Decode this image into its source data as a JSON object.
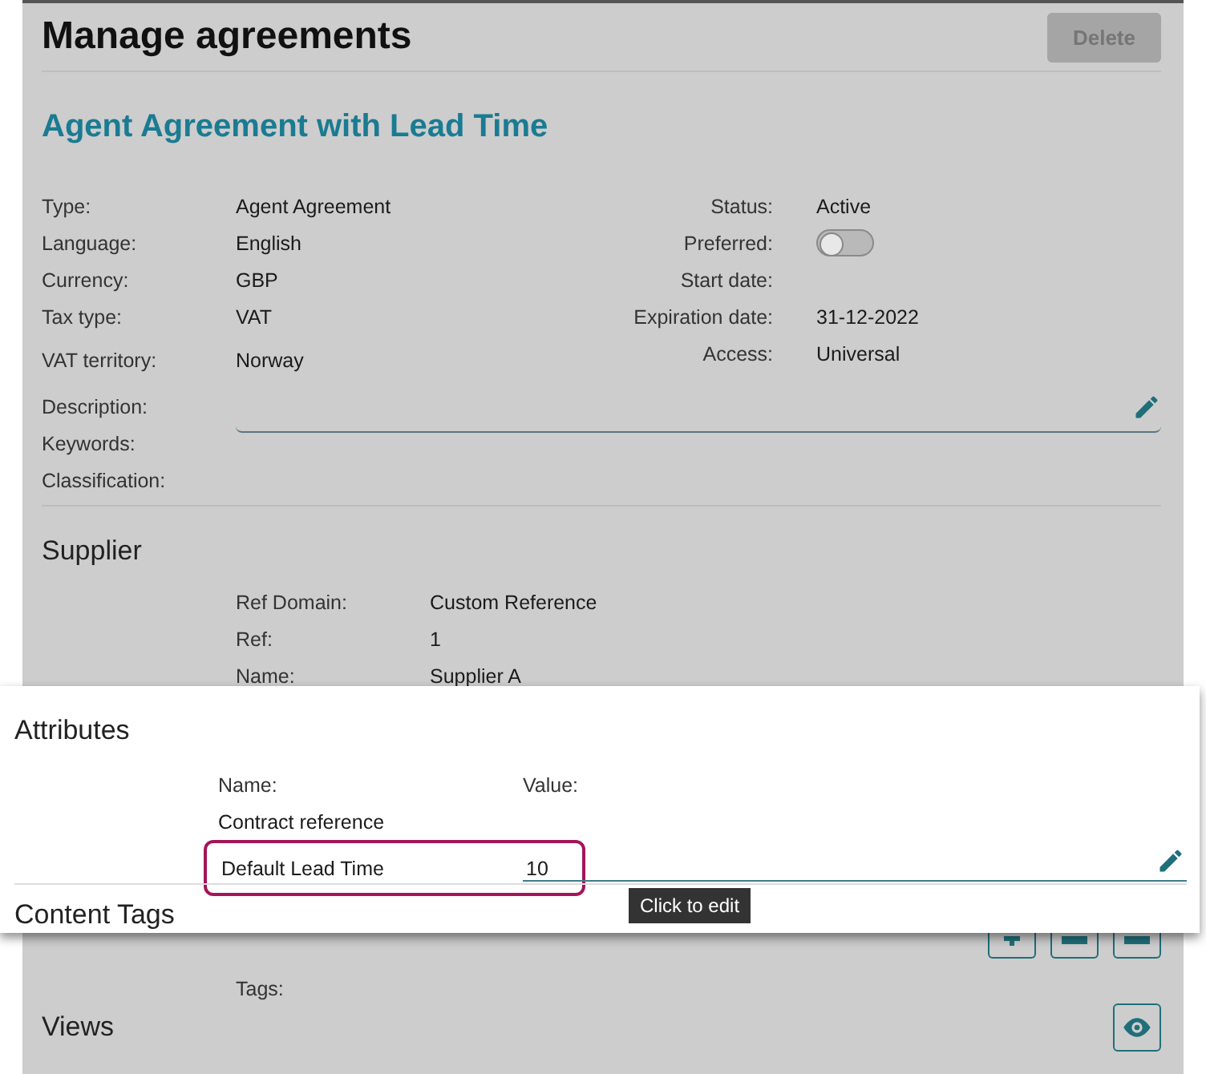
{
  "header": {
    "title": "Manage agreements",
    "delete_button": {
      "label": "Delete",
      "disabled": true
    }
  },
  "agreement": {
    "name": "Agent Agreement with Lead Time",
    "fields_left": [
      {
        "label": "Type:",
        "value": "Agent Agreement"
      },
      {
        "label": "Language:",
        "value": "English"
      },
      {
        "label": "Currency:",
        "value": "GBP"
      },
      {
        "label": "Tax type:",
        "value": "VAT"
      },
      {
        "label": "VAT territory:",
        "value": "Norway"
      }
    ],
    "fields_right": [
      {
        "kind": "text",
        "label": "Status:",
        "value": "Active"
      },
      {
        "kind": "toggle",
        "label": "Preferred:",
        "on": false
      },
      {
        "kind": "text",
        "label": "Start date:"
      },
      {
        "kind": "text",
        "label": "Expiration date:",
        "value": "31-12-2022"
      },
      {
        "kind": "text",
        "label": "Access:",
        "value": "Universal"
      }
    ],
    "text_labels": [
      "Description:",
      "Keywords:",
      "Classification:"
    ]
  },
  "supplier": {
    "heading": "Supplier",
    "rows": [
      {
        "label": "Ref Domain:",
        "value": "Custom Reference"
      },
      {
        "label": "Ref:",
        "value": "1"
      },
      {
        "label": "Name:",
        "value": "Supplier A"
      }
    ]
  },
  "attributes": {
    "heading": "Attributes",
    "columns": [
      "Name:",
      "Value:"
    ],
    "rows": [
      {
        "name": "Contract reference",
        "highlighted": false
      },
      {
        "name": "Default Lead Time",
        "value": "10",
        "highlighted": true
      }
    ],
    "tooltip": "Click to edit"
  },
  "content_tags": {
    "heading": "Content Tags",
    "tags_label": "Tags:"
  },
  "views": {
    "heading": "Views"
  }
}
